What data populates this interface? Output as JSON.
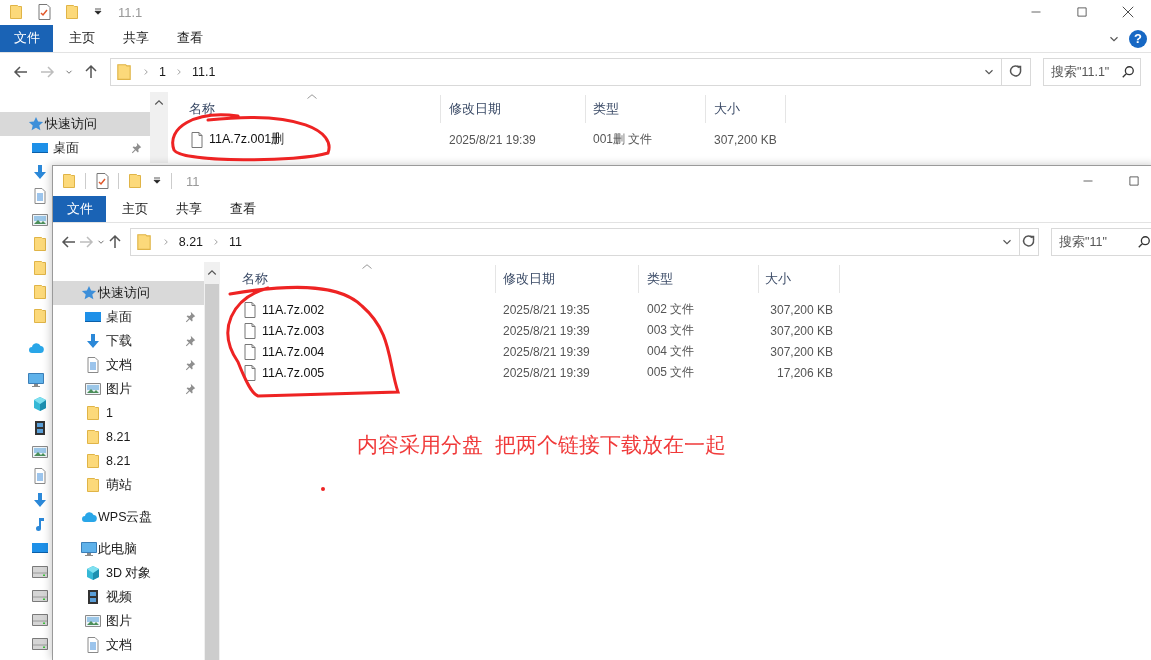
{
  "windows": [
    {
      "title": "11.1",
      "ribbon_tabs": [
        {
          "label": "文件",
          "selected": true
        },
        {
          "label": "主页",
          "selected": false
        },
        {
          "label": "共享",
          "selected": false
        },
        {
          "label": "查看",
          "selected": false
        }
      ],
      "help_button": "?",
      "breadcrumb": [
        "1",
        "11.1"
      ],
      "search": {
        "placeholder": "搜索\"11.1\""
      },
      "sidebar": [
        {
          "label": "快速访问",
          "selected": true,
          "children": [
            {
              "label": "桌面",
              "selected": false,
              "pinned": true
            }
          ]
        }
      ],
      "columns": [
        "名称",
        "修改日期",
        "类型",
        "大小"
      ],
      "files": [
        {
          "name": "11A.7z.001删",
          "modified": "2025/8/21 19:39",
          "type": "001删 文件",
          "size": "307,200 KB"
        }
      ]
    },
    {
      "title": "11",
      "ribbon_tabs": [
        {
          "label": "文件",
          "selected": true
        },
        {
          "label": "主页",
          "selected": false
        },
        {
          "label": "共享",
          "selected": false
        },
        {
          "label": "查看",
          "selected": false
        }
      ],
      "breadcrumb": [
        "8.21",
        "11"
      ],
      "search": {
        "placeholder": "搜索\"11\""
      },
      "sidebar": [
        {
          "label": "快速访问",
          "selected": true,
          "children": [
            {
              "label": "桌面",
              "selected": false,
              "pinned": true
            },
            {
              "label": "下载",
              "selected": false,
              "pinned": true
            },
            {
              "label": "文档",
              "selected": false,
              "pinned": true
            },
            {
              "label": "图片",
              "selected": false,
              "pinned": true
            },
            {
              "label": "1",
              "selected": false,
              "pinned": false
            },
            {
              "label": "8.21",
              "selected": false,
              "pinned": false
            },
            {
              "label": "8.21",
              "selected": false,
              "pinned": false
            },
            {
              "label": "萌站",
              "selected": false,
              "pinned": false
            }
          ]
        },
        {
          "label": "WPS云盘",
          "selected": false
        },
        {
          "label": "此电脑",
          "selected": false,
          "children": [
            {
              "label": "3D 对象",
              "selected": false,
              "pinned": false
            },
            {
              "label": "视频",
              "selected": false,
              "pinned": false
            },
            {
              "label": "图片",
              "selected": false,
              "pinned": false
            },
            {
              "label": "文档",
              "selected": false,
              "pinned": false
            }
          ]
        }
      ],
      "columns": [
        "名称",
        "修改日期",
        "类型",
        "大小"
      ],
      "files": [
        {
          "name": "11A.7z.002",
          "modified": "2025/8/21 19:35",
          "type": "002 文件",
          "size": "307,200 KB"
        },
        {
          "name": "11A.7z.003",
          "modified": "2025/8/21 19:39",
          "type": "003 文件",
          "size": "307,200 KB"
        },
        {
          "name": "11A.7z.004",
          "modified": "2025/8/21 19:39",
          "type": "004 文件",
          "size": "307,200 KB"
        },
        {
          "name": "11A.7z.005",
          "modified": "2025/8/21 19:39",
          "type": "005 文件",
          "size": "17,206 KB"
        }
      ]
    }
  ],
  "annotation": {
    "text": "内容采用分盘  把两个链接下载放在一起"
  }
}
